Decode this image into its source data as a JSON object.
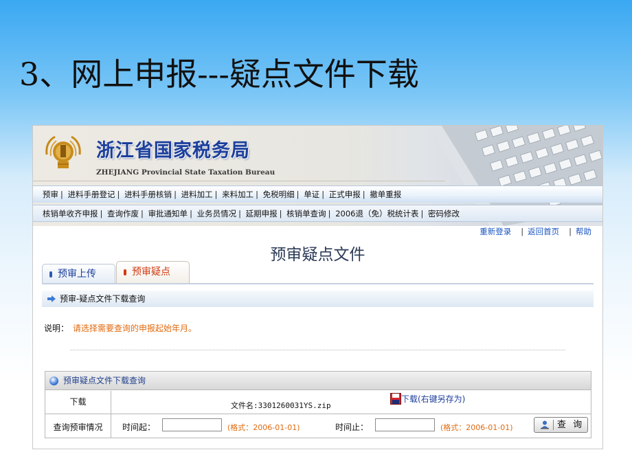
{
  "slide": {
    "title": "3、网上申报---疑点文件下载"
  },
  "site": {
    "name_cn": "浙江省国家税务局",
    "name_en": "ZHEJIANG Provincial State Taxation Bureau"
  },
  "nav": {
    "row1": [
      "预审",
      "进料手册登记",
      "进料手册核销",
      "进料加工",
      "来料加工",
      "免税明细",
      "单证",
      "正式申报",
      "撤单重报"
    ],
    "row2": [
      "核销单收齐申报",
      "查询作废",
      "审批通知单",
      "业务员情况",
      "延期申报",
      "核销单查询",
      "2006退（免）税统计表",
      "密码修改"
    ]
  },
  "top_links": {
    "relogin": "重新登录",
    "home": "返回首页",
    "help": "帮助"
  },
  "page": {
    "heading": "预审疑点文件",
    "tabs": [
      {
        "label": "预审上传",
        "active": false
      },
      {
        "label": "预审疑点",
        "active": true
      }
    ],
    "section_title": "预审-疑点文件下载查询",
    "note_label": "说明：",
    "note_text": "请选择需要查询的申报起始年月。"
  },
  "query_panel": {
    "title": "预审疑点文件下载查询",
    "download_label": "下载",
    "file_name": "文件名:3301260031YS.zip",
    "download_link": "下载(右键另存为)",
    "query_label": "查询预审情况",
    "time_from_label": "时间起：",
    "time_from_value": "",
    "time_from_format": "(格式：2006-01-01)",
    "time_to_label": "时间止：",
    "time_to_value": "",
    "time_to_format": "(格式：2006-01-01)",
    "query_button": "查 询"
  },
  "colors": {
    "link": "#1a55c0",
    "hint": "#e06a10",
    "active_tab": "#d23a10",
    "title_blue": "#1c3f9c"
  }
}
